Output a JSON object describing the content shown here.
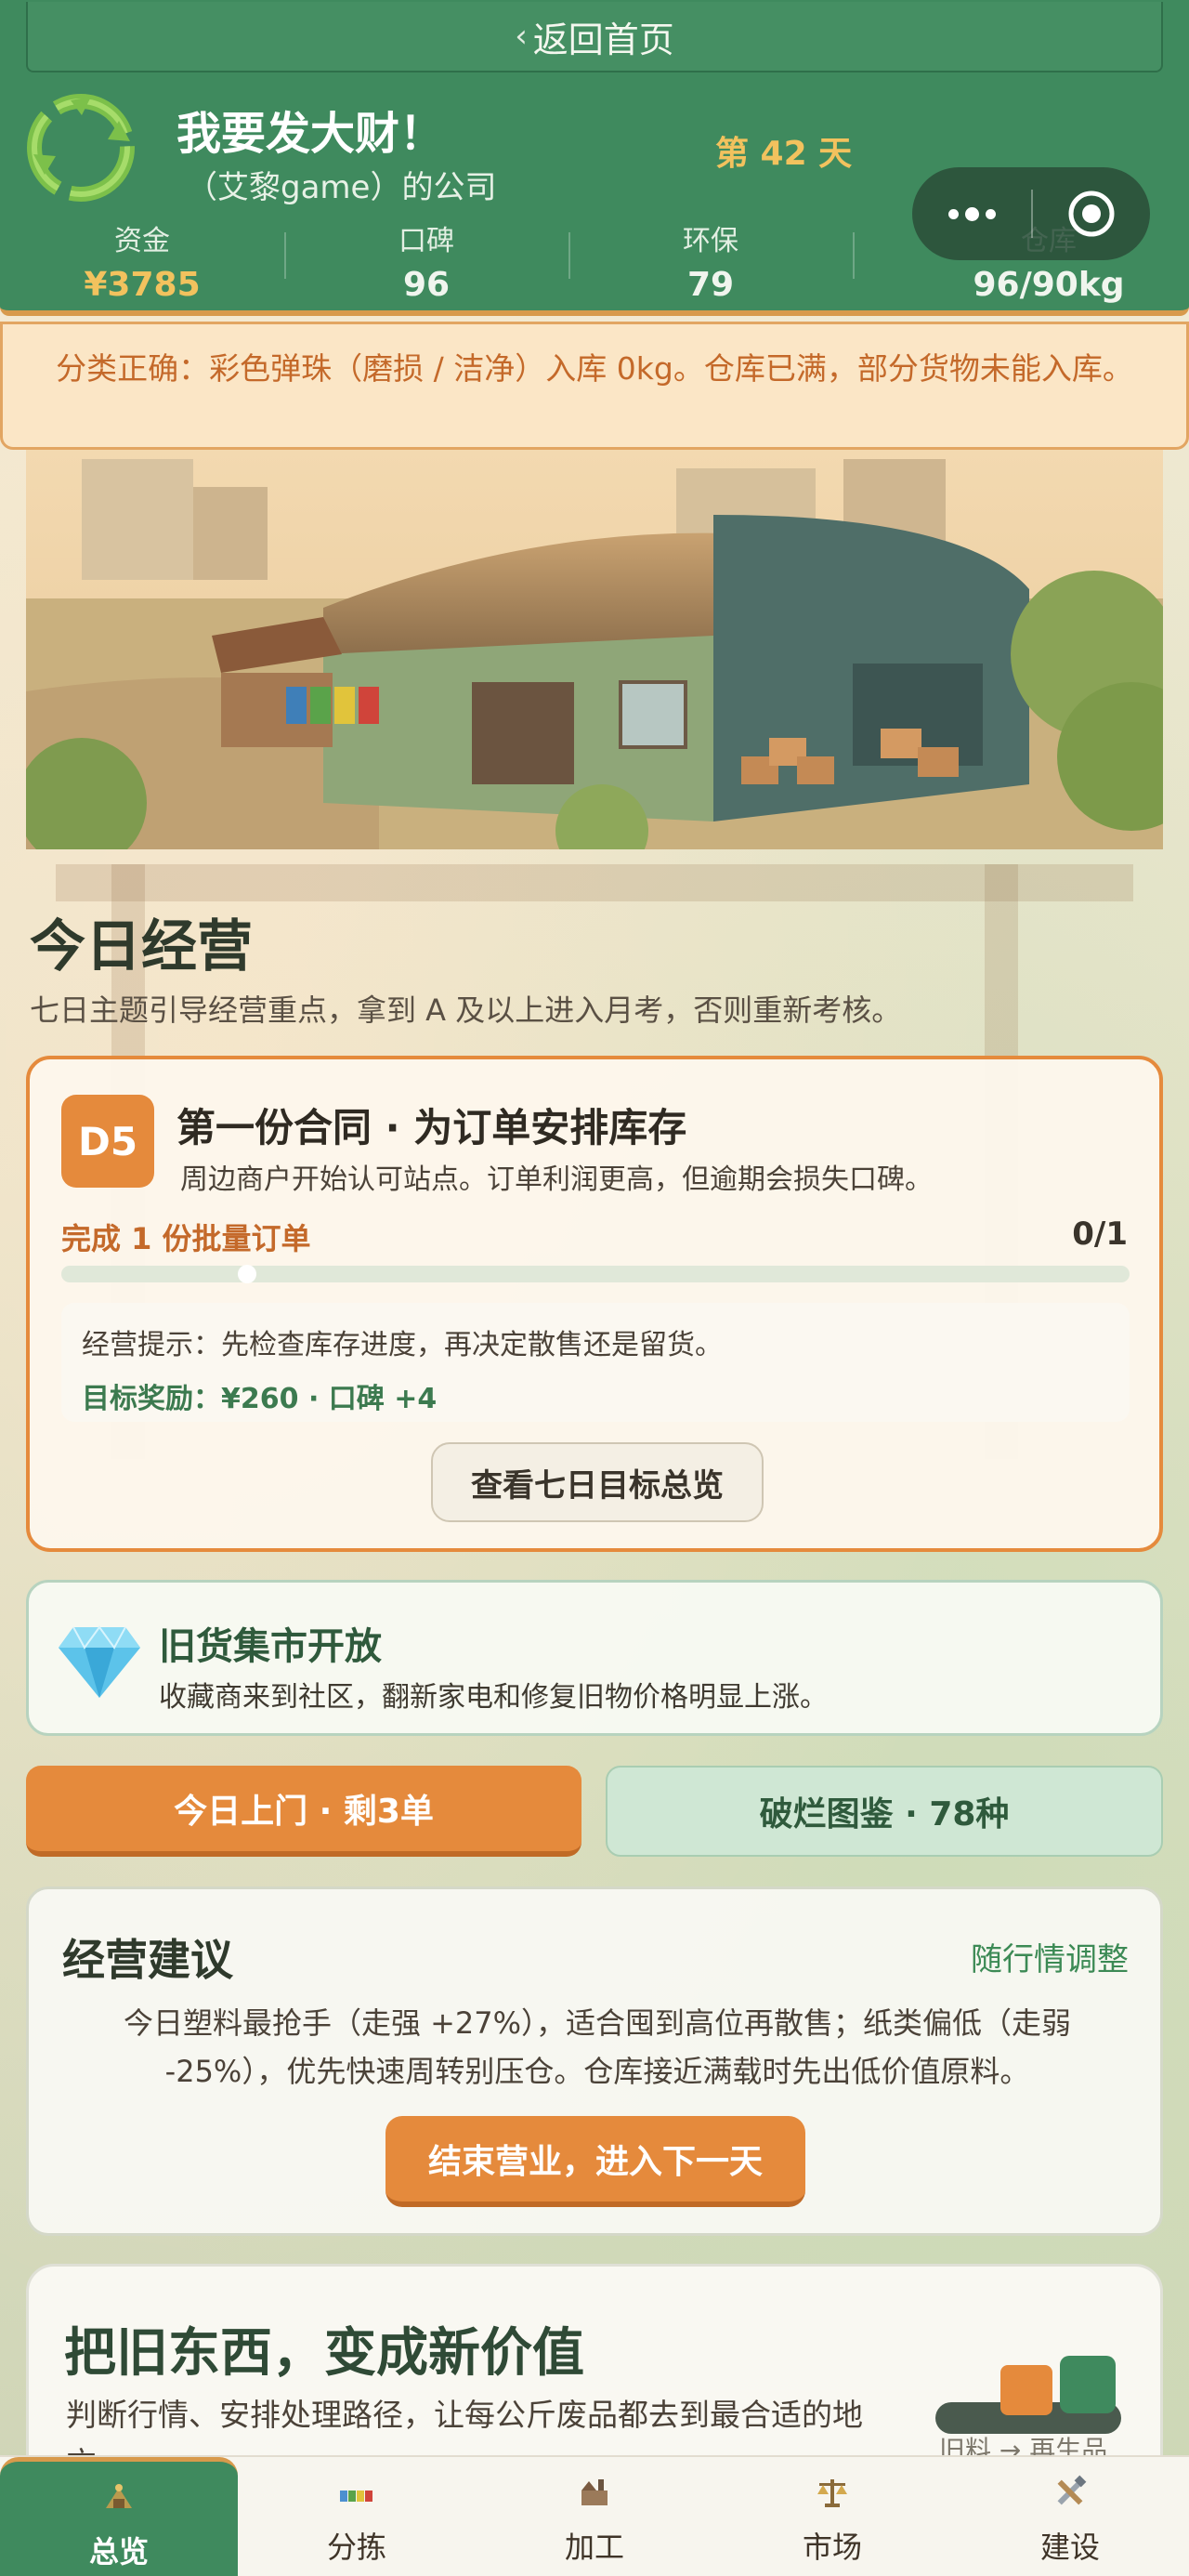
{
  "header": {
    "back_label": "返回首页",
    "company_name": "我要发大财！",
    "company_owner": "（艾黎game）的公司",
    "day_label": "第 42 天",
    "stats": [
      {
        "label": "资金",
        "value": "¥3785"
      },
      {
        "label": "口碑",
        "value": "96"
      },
      {
        "label": "环保",
        "value": "79"
      },
      {
        "label": "仓库",
        "value": "96/90kg"
      }
    ]
  },
  "notice": "分类正确：彩色弹珠（磨损 / 洁净）入库 0kg。仓库已满，部分货物未能入库。",
  "today": {
    "title": "今日经营",
    "description": "七日主题引导经营重点，拿到 A 及以上进入月考，否则重新考核。"
  },
  "task": {
    "badge": "D5",
    "title": "第一份合同 · 为订单安排库存",
    "subtitle": "周边商户开始认可站点。订单利润更高，但逾期会损失口碑。",
    "goal": "完成 1 份批量订单",
    "progress_text": "0/1",
    "progress_fraction": 0,
    "tip": "经营提示：先检查库存进度，再决定散售还是留货。",
    "reward": "目标奖励：¥260 · 口碑 +4",
    "overview_button": "查看七日目标总览"
  },
  "market": {
    "icon": "diamond-icon",
    "title": "旧货集市开放",
    "subtitle": "收藏商来到社区，翻新家电和修复旧物价格明显上涨。"
  },
  "actions": {
    "today_visits": "今日上门 · 剩3单",
    "catalog": "破烂图鉴 · 78种"
  },
  "advice": {
    "title": "经营建议",
    "tag": "随行情调整",
    "text": "今日塑料最抢手（走强 +27%），适合囤到高位再散售；纸类偏低（走弱 -25%），优先快速周转别压仓。仓库接近满载时先出低价值原料。",
    "end_button": "结束营业，进入下一天"
  },
  "promo": {
    "title": "把旧东西，变成新价值",
    "subtitle": "判断行情、安排处理路径，让每公斤废品都去到最合适的地方。",
    "tag": "旧料 → 再生品"
  },
  "tabs": [
    {
      "label": "总览",
      "icon": "overview-icon",
      "active": true
    },
    {
      "label": "分拣",
      "icon": "sorting-icon",
      "active": false
    },
    {
      "label": "加工",
      "icon": "processing-icon",
      "active": false
    },
    {
      "label": "市场",
      "icon": "market-icon",
      "active": false
    },
    {
      "label": "建设",
      "icon": "build-icon",
      "active": false
    }
  ],
  "colors": {
    "primary_green": "#3f8a5e",
    "accent_orange": "#e58a3c",
    "money_gold": "#f2c25e",
    "notice_bg": "#fbe6c6"
  }
}
